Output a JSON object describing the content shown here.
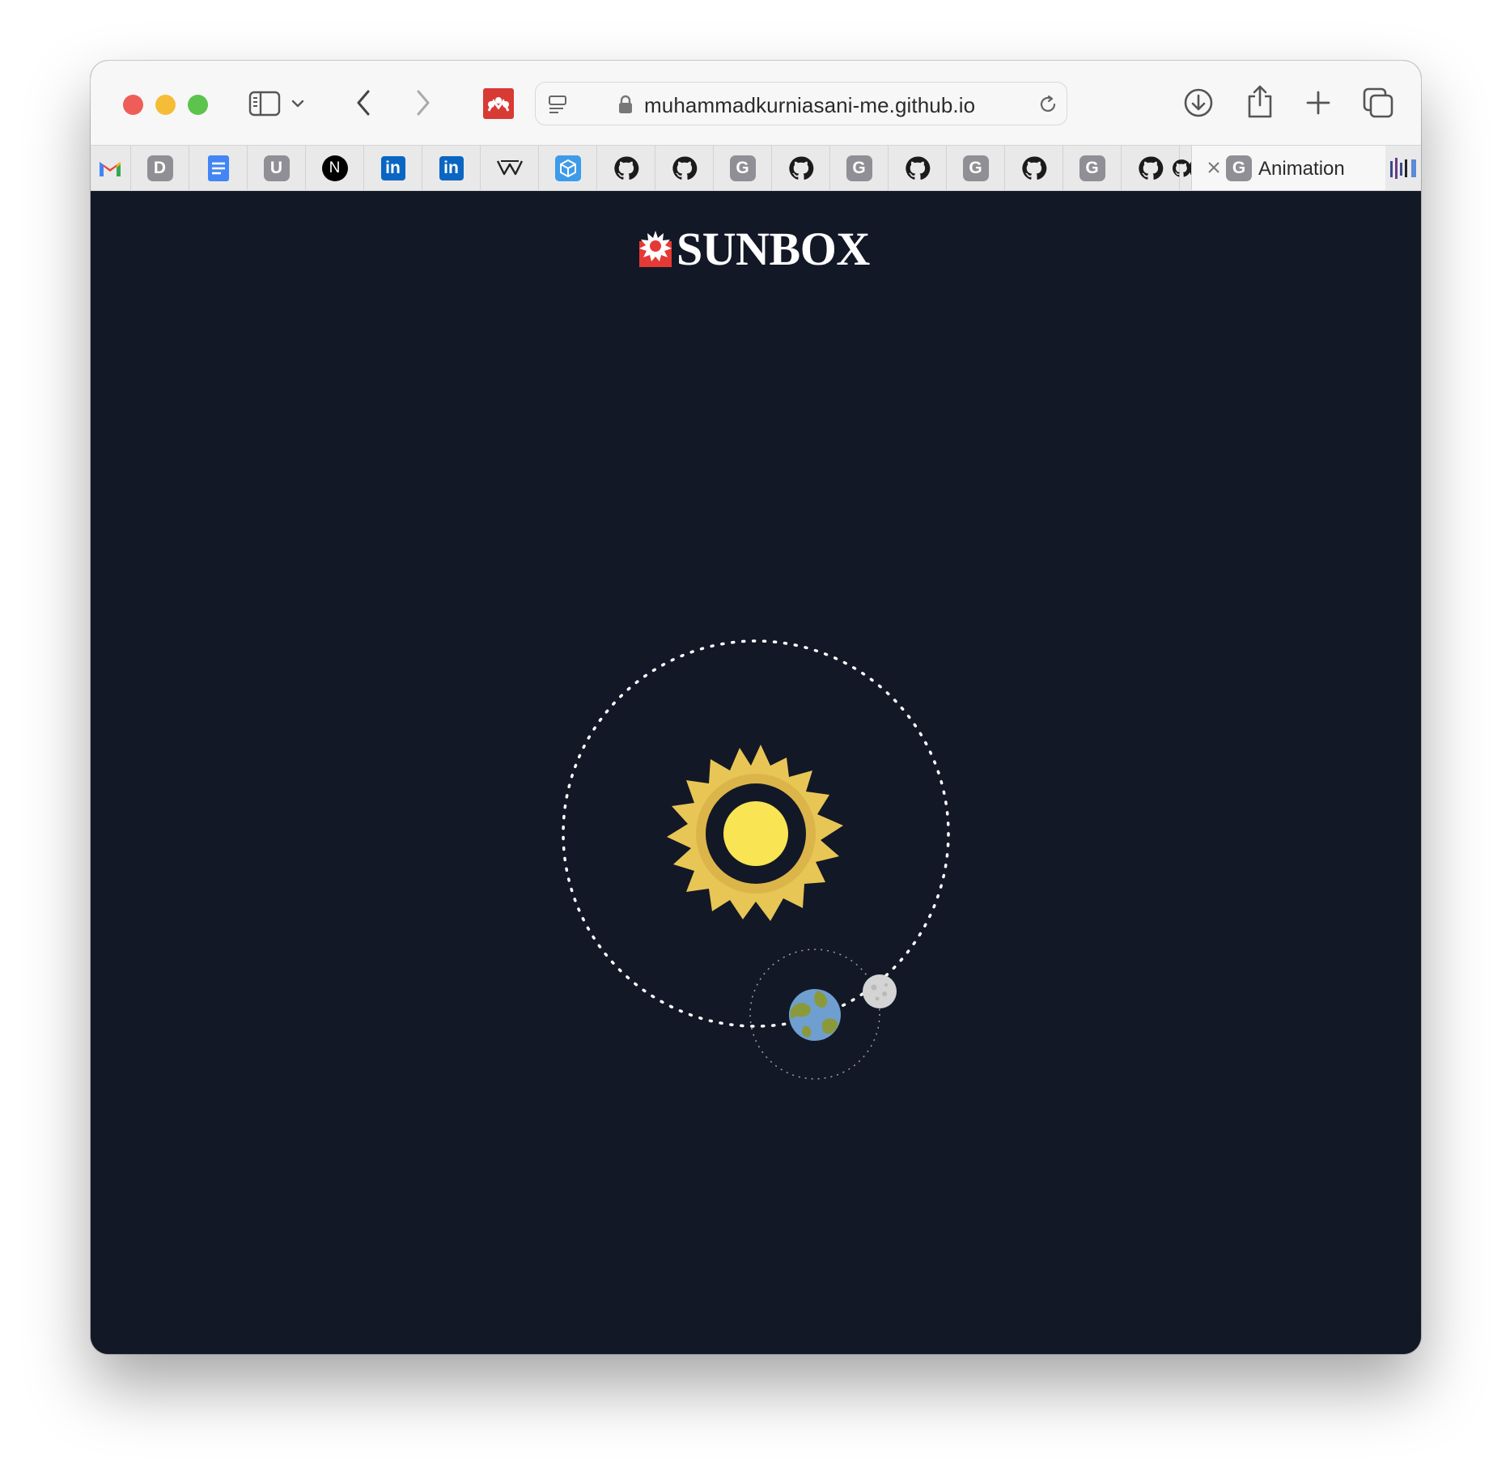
{
  "browser": {
    "url": "muhammadkurniasani-me.github.io",
    "active_tab_title": "Animation",
    "active_tab_favicon_letter": "G"
  },
  "pinned_tabs": [
    {
      "icon": "gmail-icon"
    },
    {
      "icon": "letter-badge-icon",
      "letter": "D"
    },
    {
      "icon": "google-docs-icon"
    },
    {
      "icon": "letter-badge-icon",
      "letter": "U"
    },
    {
      "icon": "nextjs-icon",
      "letter": "N"
    },
    {
      "icon": "linkedin-icon",
      "letter": "in"
    },
    {
      "icon": "linkedin-icon",
      "letter": "in"
    },
    {
      "icon": "webflow-icon"
    },
    {
      "icon": "codesandbox-icon"
    },
    {
      "icon": "github-icon"
    },
    {
      "icon": "github-icon"
    },
    {
      "icon": "letter-badge-icon",
      "letter": "G"
    },
    {
      "icon": "github-icon"
    },
    {
      "icon": "letter-badge-icon",
      "letter": "G"
    },
    {
      "icon": "github-icon"
    },
    {
      "icon": "letter-badge-icon",
      "letter": "G"
    },
    {
      "icon": "github-icon"
    },
    {
      "icon": "letter-badge-icon",
      "letter": "G"
    },
    {
      "icon": "github-icon"
    },
    {
      "icon": "github-icon"
    }
  ],
  "page": {
    "logo_text": "SUNBOX",
    "colors": {
      "background": "#131827",
      "sun_rays": "#e8c655",
      "sun_core": "#f9e453",
      "earth_ocean": "#6f9fd0",
      "earth_land": "#8a9a3a",
      "moon": "#d4d4d4",
      "brand_red": "#e53935"
    }
  }
}
